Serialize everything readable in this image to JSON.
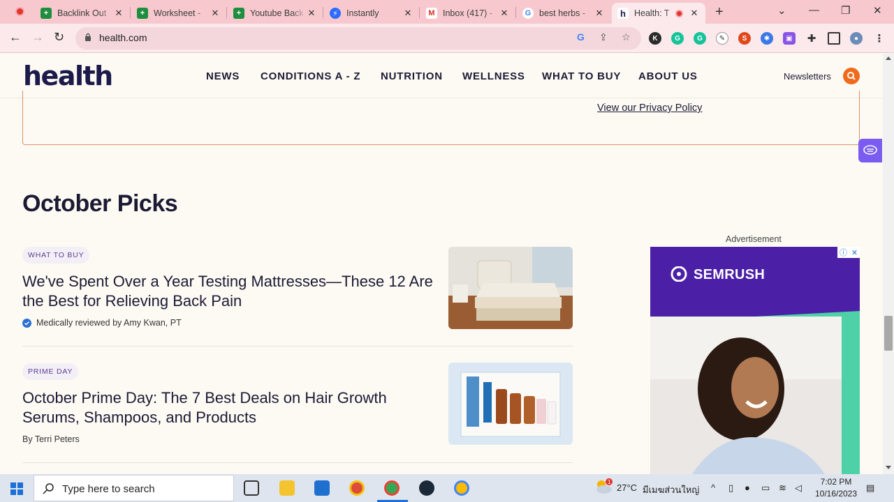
{
  "browser": {
    "tabs": [
      {
        "title": "Backlink Out",
        "favicon": "sheets-icon",
        "color": "#1e8e3e"
      },
      {
        "title": "Worksheet - ",
        "favicon": "sheets-icon",
        "color": "#1e8e3e"
      },
      {
        "title": "Youtube Back",
        "favicon": "sheets-icon",
        "color": "#1e8e3e"
      },
      {
        "title": "Instantly",
        "favicon": "instantly-icon",
        "color": "#2f6bff"
      },
      {
        "title": "Inbox (417) -",
        "favicon": "gmail-icon",
        "color": "#d93025"
      },
      {
        "title": "best herbs -",
        "favicon": "google-icon",
        "color": "#4285f4"
      },
      {
        "title": "Health: T",
        "favicon": "health-icon",
        "color": "#1c1a4a"
      }
    ],
    "url": "health.com"
  },
  "site": {
    "logo": "health",
    "nav": [
      "NEWS",
      "CONDITIONS A - Z",
      "NUTRITION",
      "WELLNESS",
      "WHAT TO BUY",
      "ABOUT US"
    ],
    "newsletters": "Newsletters",
    "privacy_link": "View our Privacy Policy"
  },
  "section": {
    "title": "October Picks",
    "articles": [
      {
        "tag": "WHAT TO BUY",
        "headline": "We've Spent Over a Year Testing Mattresses—These 12 Are the Best for Relieving Back Pain",
        "byline": "Medically reviewed by Amy Kwan, PT"
      },
      {
        "tag": "PRIME DAY",
        "headline": "October Prime Day: The 7 Best Deals on Hair Growth Serums, Shampoos, and Products",
        "byline": "By Terri Peters"
      }
    ]
  },
  "ad": {
    "label": "Advertisement",
    "brand": "SEMRUSH"
  },
  "taskbar": {
    "search_placeholder": "Type here to search",
    "weather": "27°C",
    "weather_location": "มีเมฆส่วนใหญ่",
    "time": "7:02 PM",
    "date": "10/16/2023"
  }
}
